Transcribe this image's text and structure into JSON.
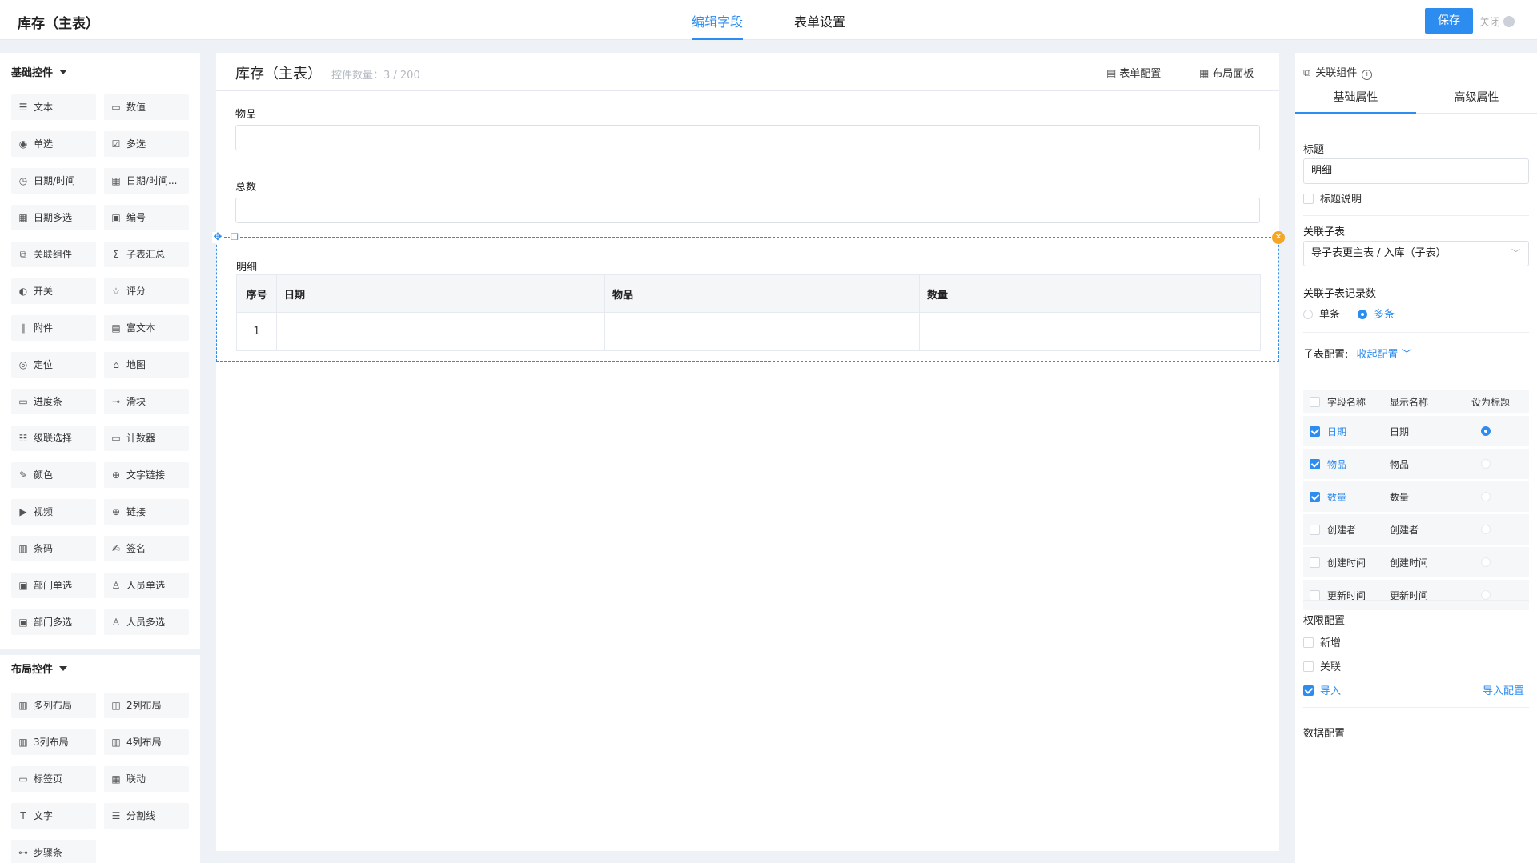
{
  "app": {
    "title": "库存（主表）"
  },
  "top_tabs": [
    {
      "label": "编辑字段",
      "active": true
    },
    {
      "label": "表单设置",
      "active": false
    }
  ],
  "actions": {
    "save": "保存",
    "close": "关闭"
  },
  "palette": {
    "basic": {
      "title": "基础控件",
      "items": [
        {
          "label": "文本",
          "icon": "text-icon"
        },
        {
          "label": "数值",
          "icon": "number-icon"
        },
        {
          "label": "单选",
          "icon": "radio-icon"
        },
        {
          "label": "多选",
          "icon": "checkbox-icon"
        },
        {
          "label": "日期/时间",
          "icon": "clock-icon"
        },
        {
          "label": "日期/时间...",
          "icon": "calendar-icon"
        },
        {
          "label": "日期多选",
          "icon": "calendar-multi-icon"
        },
        {
          "label": "编号",
          "icon": "serial-icon"
        },
        {
          "label": "关联组件",
          "icon": "link-component-icon"
        },
        {
          "label": "子表汇总",
          "icon": "sigma-icon"
        },
        {
          "label": "开关",
          "icon": "toggle-icon"
        },
        {
          "label": "评分",
          "icon": "star-icon"
        },
        {
          "label": "附件",
          "icon": "paperclip-icon"
        },
        {
          "label": "富文本",
          "icon": "rich-text-icon"
        },
        {
          "label": "定位",
          "icon": "location-icon"
        },
        {
          "label": "地图",
          "icon": "map-icon"
        },
        {
          "label": "进度条",
          "icon": "progress-icon"
        },
        {
          "label": "滑块",
          "icon": "slider-icon"
        },
        {
          "label": "级联选择",
          "icon": "cascade-icon"
        },
        {
          "label": "计数器",
          "icon": "counter-icon"
        },
        {
          "label": "颜色",
          "icon": "color-picker-icon"
        },
        {
          "label": "文字链接",
          "icon": "globe-icon"
        },
        {
          "label": "视频",
          "icon": "video-icon"
        },
        {
          "label": "链接",
          "icon": "globe-icon"
        },
        {
          "label": "条码",
          "icon": "barcode-icon"
        },
        {
          "label": "签名",
          "icon": "signature-icon"
        },
        {
          "label": "部门单选",
          "icon": "department-icon"
        },
        {
          "label": "人员单选",
          "icon": "user-icon"
        },
        {
          "label": "部门多选",
          "icon": "departments-icon"
        },
        {
          "label": "人员多选",
          "icon": "users-icon"
        }
      ]
    },
    "layout": {
      "title": "布局控件",
      "items": [
        {
          "label": "多列布局",
          "icon": "columns-icon"
        },
        {
          "label": "2列布局",
          "icon": "columns-2-icon"
        },
        {
          "label": "3列布局",
          "icon": "columns-3-icon"
        },
        {
          "label": "4列布局",
          "icon": "columns-4-icon"
        },
        {
          "label": "标签页",
          "icon": "tabs-icon"
        },
        {
          "label": "联动",
          "icon": "grid-icon"
        },
        {
          "label": "文字",
          "icon": "text-t-icon"
        },
        {
          "label": "分割线",
          "icon": "divider-icon"
        },
        {
          "label": "步骤条",
          "icon": "steps-icon"
        }
      ]
    }
  },
  "canvas": {
    "title": "库存（主表）",
    "count_label": "控件数量：3 / 200",
    "actions": [
      {
        "label": "表单配置",
        "icon": "form-config-icon"
      },
      {
        "label": "布局面板",
        "icon": "layout-grid-icon"
      }
    ],
    "fields": [
      {
        "label": "物品",
        "value": ""
      },
      {
        "label": "总数",
        "value": ""
      }
    ],
    "subtable": {
      "title": "明细",
      "columns": [
        "序号",
        "日期",
        "物品",
        "数量"
      ],
      "rows": [
        [
          "1",
          "",
          "",
          ""
        ]
      ]
    }
  },
  "panel": {
    "header": "关联组件",
    "tabs": [
      {
        "label": "基础属性",
        "active": true
      },
      {
        "label": "高级属性",
        "active": false
      }
    ],
    "title_label": "标题",
    "title_value": "明细",
    "title_desc": {
      "label": "标题说明",
      "checked": false
    },
    "link_table_label": "关联子表",
    "link_table_value": "导子表更主表 / 入库（子表）",
    "record_count_label": "关联子表记录数",
    "record_options": [
      {
        "label": "单条",
        "selected": false
      },
      {
        "label": "多条",
        "selected": true
      }
    ],
    "subtable_config": {
      "label": "子表配置:",
      "toggle": "收起配置",
      "headers": [
        "字段名称",
        "显示名称",
        "设为标题"
      ],
      "rows": [
        {
          "field": "日期",
          "display": "日期",
          "checked": true,
          "is_title": true
        },
        {
          "field": "物品",
          "display": "物品",
          "checked": true,
          "is_title": false
        },
        {
          "field": "数量",
          "display": "数量",
          "checked": true,
          "is_title": false
        },
        {
          "field": "创建者",
          "display": "创建者",
          "checked": false,
          "is_title": false
        },
        {
          "field": "创建时间",
          "display": "创建时间",
          "checked": false,
          "is_title": false
        },
        {
          "field": "更新时间",
          "display": "更新时间",
          "checked": false,
          "is_title": false
        }
      ]
    },
    "permission": {
      "label": "权限配置",
      "items": [
        {
          "label": "新增",
          "checked": false
        },
        {
          "label": "关联",
          "checked": false
        },
        {
          "label": "导入",
          "checked": true
        }
      ],
      "import_config": "导入配置"
    },
    "data_config_label": "数据配置"
  },
  "colors": {
    "accent": "#2d8cf0",
    "warn": "#f5a623",
    "bg": "#eef1f5"
  }
}
